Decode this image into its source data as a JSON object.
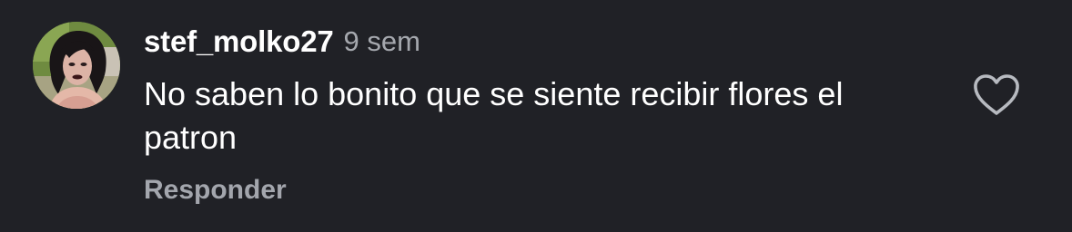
{
  "comment": {
    "username": "stef_molko27",
    "time": "9 sem",
    "text": "No saben lo bonito que se siente recibir flores el patron",
    "reply_label": "Responder",
    "avatar_icon": "user-avatar-photo",
    "like_icon": "heart-outline-icon"
  },
  "colors": {
    "background": "#202126",
    "text": "#ffffff",
    "muted": "#a5a8ae"
  }
}
